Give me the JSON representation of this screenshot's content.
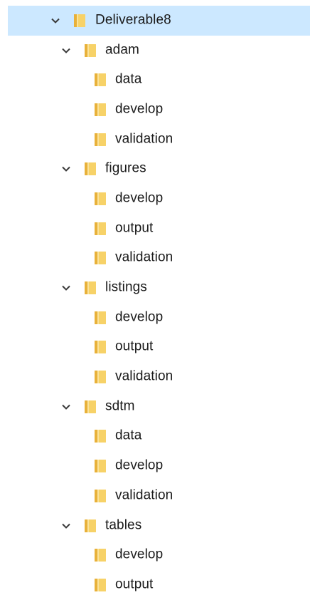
{
  "tree": {
    "root": {
      "label": "Deliverable8",
      "icon": "folder-icon",
      "expanded": true,
      "selected": true
    },
    "folders": [
      {
        "label": "adam",
        "expanded": true,
        "children": [
          "data",
          "develop",
          "validation"
        ]
      },
      {
        "label": "figures",
        "expanded": true,
        "children": [
          "develop",
          "output",
          "validation"
        ]
      },
      {
        "label": "listings",
        "expanded": true,
        "children": [
          "develop",
          "output",
          "validation"
        ]
      },
      {
        "label": "sdtm",
        "expanded": true,
        "children": [
          "data",
          "develop",
          "validation"
        ]
      },
      {
        "label": "tables",
        "expanded": true,
        "children": [
          "develop",
          "output"
        ]
      }
    ]
  },
  "colors": {
    "selection": "#cce8ff",
    "folder_body": "#f7d268",
    "folder_tab": "#e8b13a",
    "chevron": "#3a3a3a"
  }
}
